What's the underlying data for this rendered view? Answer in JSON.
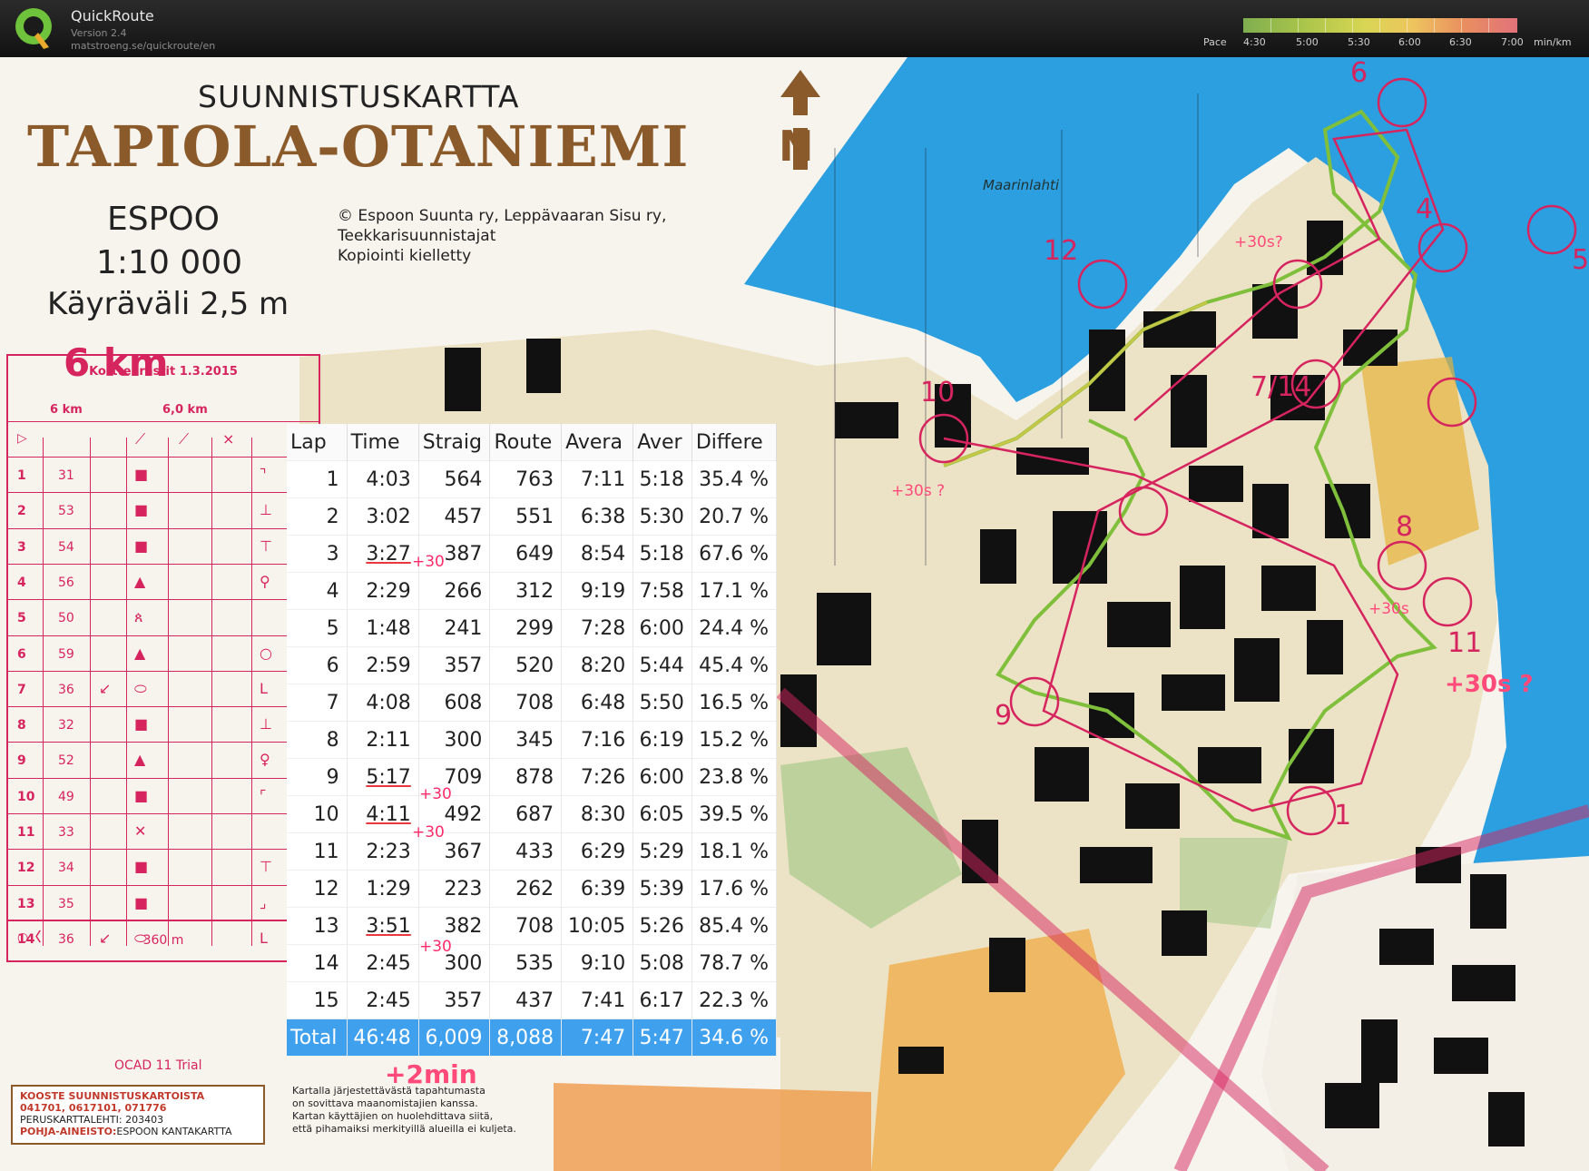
{
  "app": {
    "name": "QuickRoute",
    "version": "Version 2.4",
    "url": "matstroeng.se/quickroute/en"
  },
  "pace_scale": {
    "label": "Pace",
    "ticks": [
      "4:30",
      "5:00",
      "5:30",
      "6:00",
      "6:30",
      "7:00"
    ],
    "unit": "min/km"
  },
  "map": {
    "supertitle": "SUUNNISTUSKARTTA",
    "title": "TAPIOLA-OTANIEMI",
    "city": "ESPOO",
    "scale": "1:10 000",
    "contour": "Käyräväli 2,5 m",
    "copyright": [
      "© Espoon Suunta ry, Leppävaaran Sisu ry,",
      "Teekkarisuunnistajat",
      " Kopiointi kielletty"
    ],
    "course_length": "6 km",
    "place_name": "Maarinlahti",
    "ocad": "OCAD 11 Trial",
    "kooste": {
      "title": "KOOSTE SUUNNISTUSKARTOISTA",
      "codes": "041701, 0617101, 071776",
      "peruskartta": "PERUSKARTTALEHTI: 203403",
      "pohja_label": "POHJA-AINEISTO:",
      "pohja_value": "ESPOON KANTAKARTTA"
    },
    "note": [
      "Kartalla järjestettävästä tapahtumasta",
      "on sovittava maanomistajien kanssa.",
      "Kartan käyttäjien on huolehdittava siitä,",
      "että pihamaiksi merkityillä alueilla ei kuljeta."
    ]
  },
  "control_desc": {
    "title": "Korttelirastit 1.3.2015",
    "course": "6 km",
    "length": "6,0 km",
    "finish_dist": "360 m",
    "rows": [
      {
        "n": "1",
        "code": "31",
        "x": "",
        "sym": "■",
        "r": "⌝"
      },
      {
        "n": "2",
        "code": "53",
        "x": "",
        "sym": "■",
        "r": "⊥"
      },
      {
        "n": "3",
        "code": "54",
        "x": "",
        "sym": "■",
        "r": "⊤"
      },
      {
        "n": "4",
        "code": "56",
        "x": "",
        "sym": "▲",
        "r": "⚲"
      },
      {
        "n": "5",
        "code": "50",
        "x": "",
        "sym": "ጰ",
        "r": ""
      },
      {
        "n": "6",
        "code": "59",
        "x": "",
        "sym": "▲",
        "r": "○"
      },
      {
        "n": "7",
        "code": "36",
        "x": "↙",
        "sym": "⬭",
        "r": "L"
      },
      {
        "n": "8",
        "code": "32",
        "x": "",
        "sym": "■",
        "r": "⊥"
      },
      {
        "n": "9",
        "code": "52",
        "x": "",
        "sym": "▲",
        "r": "♀"
      },
      {
        "n": "10",
        "code": "49",
        "x": "",
        "sym": "■",
        "r": "⌜"
      },
      {
        "n": "11",
        "code": "33",
        "x": "",
        "sym": "✕",
        "r": ""
      },
      {
        "n": "12",
        "code": "34",
        "x": "",
        "sym": "■",
        "r": "⊤"
      },
      {
        "n": "13",
        "code": "35",
        "x": "",
        "sym": "■",
        "r": "⌟"
      },
      {
        "n": "14",
        "code": "36",
        "x": "↙",
        "sym": "⬭",
        "r": "L"
      }
    ]
  },
  "laps": {
    "headers": [
      "Lap",
      "Time",
      "Straig",
      "Route",
      "Avera",
      "Aver",
      "Differe"
    ],
    "rows": [
      [
        "1",
        "4:03",
        "564",
        "763",
        "7:11",
        "5:18",
        "35.4 %"
      ],
      [
        "2",
        "3:02",
        "457",
        "551",
        "6:38",
        "5:30",
        "20.7 %"
      ],
      [
        "3",
        "3:27",
        "387",
        "649",
        "8:54",
        "5:18",
        "67.6 %"
      ],
      [
        "4",
        "2:29",
        "266",
        "312",
        "9:19",
        "7:58",
        "17.1 %"
      ],
      [
        "5",
        "1:48",
        "241",
        "299",
        "7:28",
        "6:00",
        "24.4 %"
      ],
      [
        "6",
        "2:59",
        "357",
        "520",
        "8:20",
        "5:44",
        "45.4 %"
      ],
      [
        "7",
        "4:08",
        "608",
        "708",
        "6:48",
        "5:50",
        "16.5 %"
      ],
      [
        "8",
        "2:11",
        "300",
        "345",
        "7:16",
        "6:19",
        "15.2 %"
      ],
      [
        "9",
        "5:17",
        "709",
        "878",
        "7:26",
        "6:00",
        "23.8 %"
      ],
      [
        "10",
        "4:11",
        "492",
        "687",
        "8:30",
        "6:05",
        "39.5 %"
      ],
      [
        "11",
        "2:23",
        "367",
        "433",
        "6:29",
        "5:29",
        "18.1 %"
      ],
      [
        "12",
        "1:29",
        "223",
        "262",
        "6:39",
        "5:39",
        "17.6 %"
      ],
      [
        "13",
        "3:51",
        "382",
        "708",
        "10:05",
        "5:26",
        "85.4 %"
      ],
      [
        "14",
        "2:45",
        "300",
        "535",
        "9:10",
        "5:08",
        "78.7 %"
      ],
      [
        "15",
        "2:45",
        "357",
        "437",
        "7:41",
        "6:17",
        "22.3 %"
      ]
    ],
    "total": [
      "Total",
      "46:48",
      "6,009",
      "8,088",
      "7:47",
      "5:47",
      "34.6 %"
    ]
  },
  "annotations": {
    "plus30": "+30",
    "plus2min": "+2min",
    "map_a": "+30s ?",
    "map_b": "+30s ?",
    "map_c": "+30s?",
    "map_d": "+30s"
  },
  "controls": [
    "6",
    "5",
    "4",
    "12",
    "10",
    "7/14",
    "8",
    "9",
    "1",
    "11"
  ],
  "colors": {
    "course": "#d6245f",
    "water": "#2b9fe0",
    "total_row": "#3fa0ee",
    "title_brown": "#8b5a2b"
  }
}
